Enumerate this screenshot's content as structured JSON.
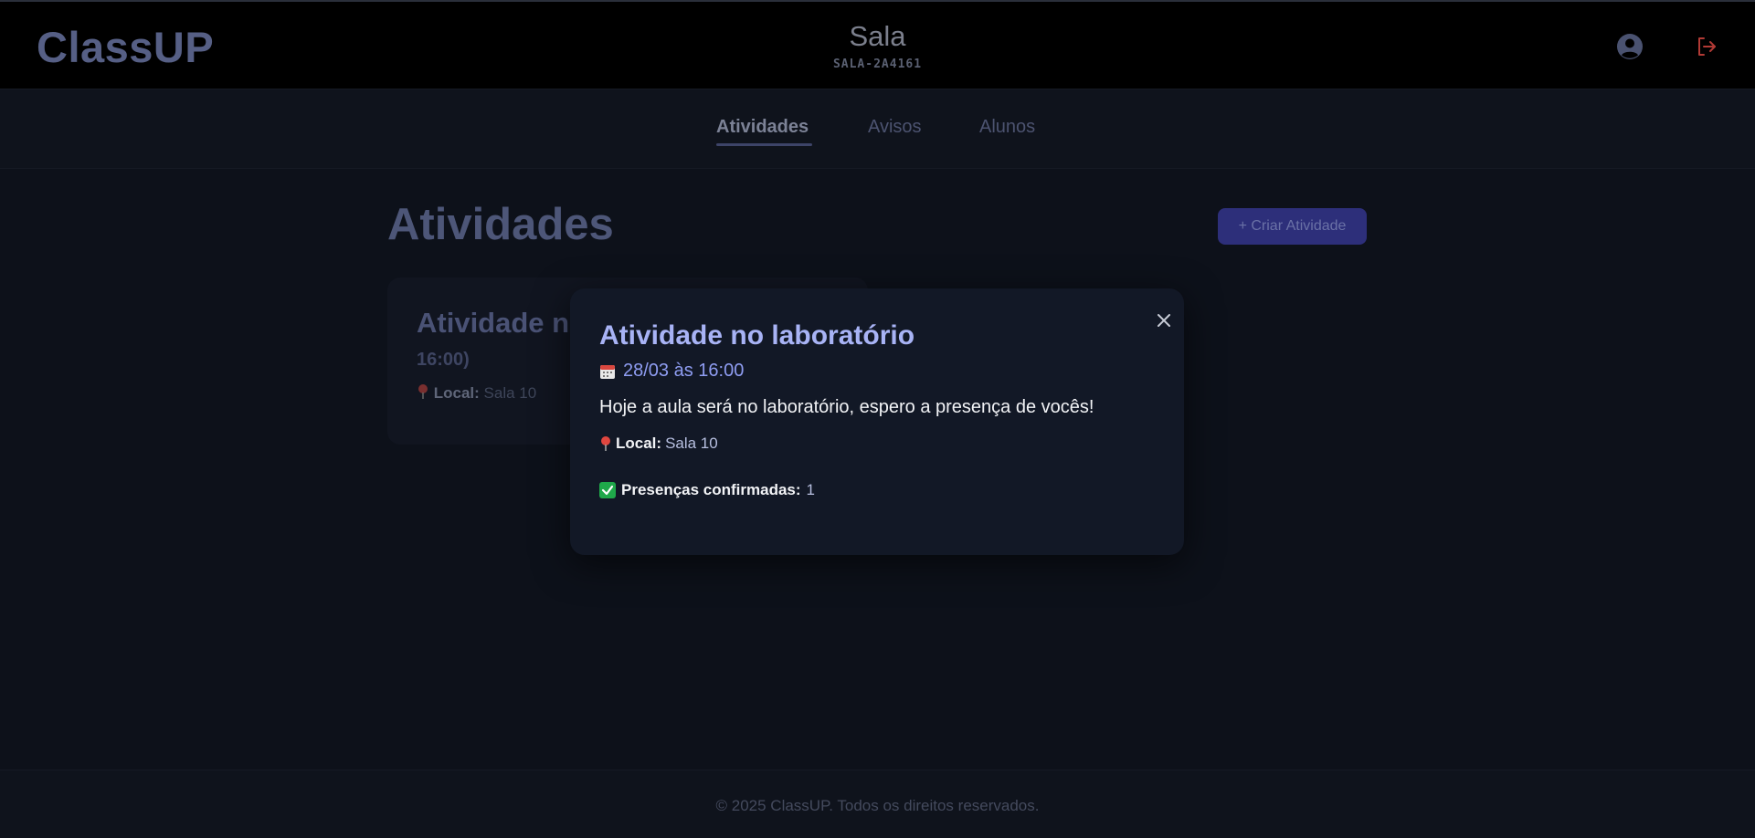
{
  "header": {
    "logo": "ClassUP",
    "title": "Sala",
    "code": "SALA-2A4161",
    "profile_icon": "user-circle-icon",
    "logout_icon": "logout-icon"
  },
  "tabs": [
    {
      "label": "Atividades",
      "active": true
    },
    {
      "label": "Avisos",
      "active": false
    },
    {
      "label": "Alunos",
      "active": false
    }
  ],
  "main": {
    "title": "Atividades",
    "create_button": "+ Criar Atividade"
  },
  "card": {
    "title": "Atividade no laboratório (28/03 às",
    "date_fragment": "16:00)",
    "location_label": "Local:",
    "location_value": "Sala 10"
  },
  "modal": {
    "title": "Atividade no laboratório",
    "date": "28/03 às 16:00",
    "description": "Hoje a aula será no laboratório, espero a presença de vocês!",
    "location_label": "Local:",
    "location_value": "Sala 10",
    "presence_label": "Presenças confirmadas:",
    "presence_value": "1"
  },
  "footer": {
    "text": "© 2025 ClassUP. Todos os direitos reservados."
  },
  "colors": {
    "accent": "#a8b3f5",
    "button_bg": "#2d2f7a",
    "logout": "#c0392b",
    "check": "#22c55e"
  }
}
